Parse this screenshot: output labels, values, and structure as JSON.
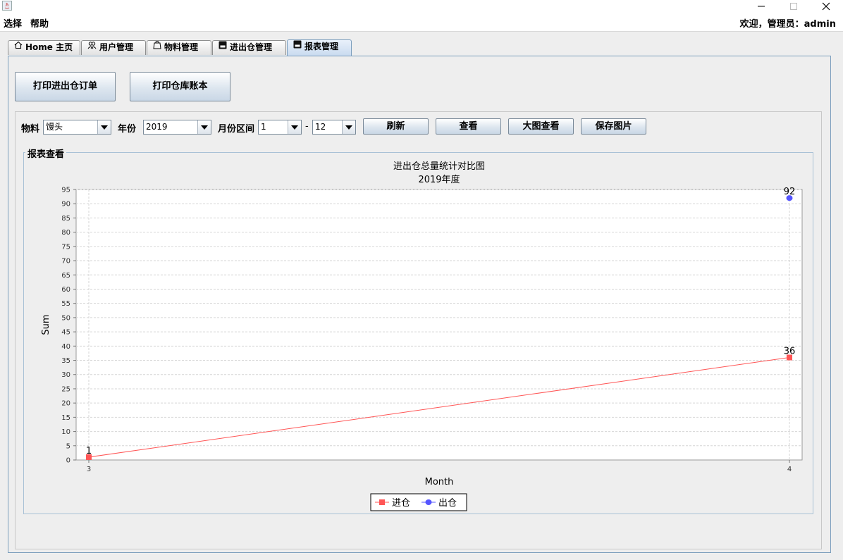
{
  "window": {
    "minimize": "minimize",
    "maximize": "maximize",
    "close": "close"
  },
  "menu": {
    "items": [
      "选择",
      "帮助"
    ],
    "welcome": "欢迎，管理员：admin"
  },
  "tabs": [
    {
      "label": "Home 主页",
      "icon": "home-icon"
    },
    {
      "label": "用户管理",
      "icon": "users-icon"
    },
    {
      "label": "物料管理",
      "icon": "bag-icon"
    },
    {
      "label": "进出仓管理",
      "icon": "save-icon"
    },
    {
      "label": "报表管理",
      "icon": "save-icon",
      "active": true
    }
  ],
  "actions": {
    "print_order": "打印进出仓订单",
    "print_ledger": "打印仓库账本"
  },
  "filters": {
    "material_label": "物料",
    "material_value": "馒头",
    "year_label": "年份",
    "year_value": "2019",
    "month_label": "月份区间",
    "month_from": "1",
    "month_sep": "-",
    "month_to": "12"
  },
  "buttons": {
    "refresh": "刷新",
    "view": "查看",
    "big_view": "大图查看",
    "save_image": "保存图片"
  },
  "report": {
    "section_title": "报表查看"
  },
  "chart_data": {
    "type": "line",
    "title": "进出仓总量统计对比图",
    "subtitle": "2019年度",
    "xlabel": "Month",
    "ylabel": "Sum",
    "x": [
      "3",
      "4"
    ],
    "ylim": [
      0,
      95
    ],
    "ytick_step": 5,
    "grid": true,
    "legend": "bottom",
    "series": [
      {
        "name": "进仓",
        "marker": "square",
        "color": "#ff5555",
        "values": [
          1,
          36
        ]
      },
      {
        "name": "出仓",
        "marker": "circle",
        "color": "#5555ff",
        "values": [
          null,
          92
        ]
      }
    ]
  }
}
